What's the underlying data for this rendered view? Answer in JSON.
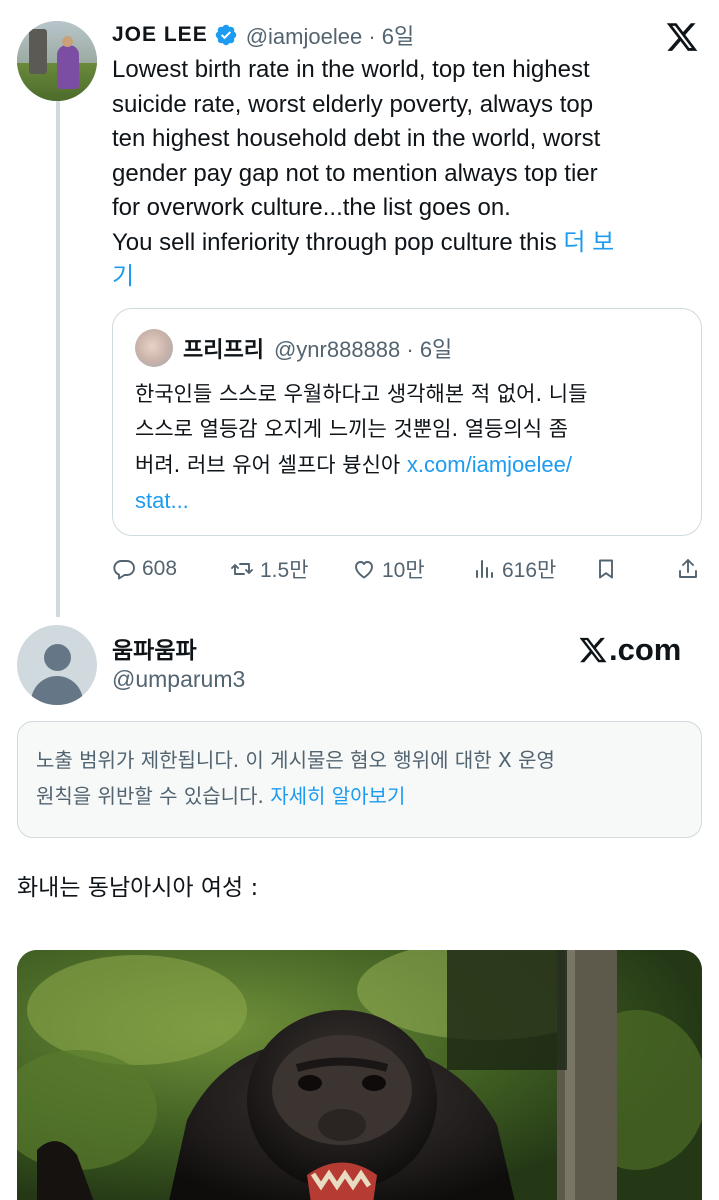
{
  "colors": {
    "accent": "#1d9bf0",
    "text": "#0f1419",
    "secondary": "#536471",
    "border": "#cfd9de",
    "notice_bg": "#f7f9f9"
  },
  "post": {
    "author_name": "JOE LEE",
    "verified_icon": "verified-badge-icon",
    "handle_time": "@iamjoelee · 6일",
    "text_lines": [
      "Lowest birth rate in the world, top ten highest",
      "suicide rate, worst elderly poverty,  always top",
      "ten highest household debt in the world, worst",
      "gender pay gap not to mention always top tier",
      "for overwork culture...the list goes on.",
      "You sell inferiority through pop culture this "
    ],
    "more_label_1": "더 보",
    "more_label_2": "기",
    "quote": {
      "name": "프리프리",
      "handle_time": "@ynr888888 · 6일",
      "text_lines": [
        "한국인들 스스로 우월하다고 생각해본 적 없어. 니들",
        "스스로 열등감 오지게 느끼는 것뿐임. 열등의식 좀",
        "버려. 러브 유어 셀프다 븅신아 "
      ],
      "link_1": "x.com/iamjoelee/",
      "link_2": "stat..."
    },
    "actions": {
      "reply_count": "608",
      "repost_count": "1.5만",
      "like_count": "10만",
      "view_count": "616만"
    }
  },
  "second_post": {
    "name": "움파움파",
    "handle": "@umparum3",
    "brand": ".com",
    "notice_lines": [
      "노출 범위가 제한됩니다. 이 게시물은 혐오 행위에 대한 X 운영",
      "원칙을 위반할 수 있습니다. "
    ],
    "notice_link": "자세히 알아보기",
    "text": "화내는 동남아시아 여성 :"
  }
}
